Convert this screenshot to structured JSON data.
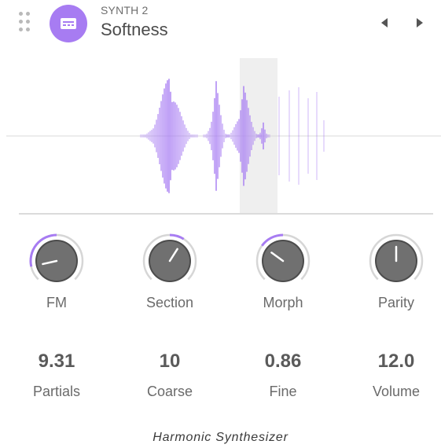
{
  "header": {
    "device_type": "SYNTH 2",
    "preset_name": "Softness",
    "accent_color": "#a77cf2"
  },
  "icons": {
    "drag": "drag-handle-icon",
    "device": "synth-device-icon",
    "prev": "triangle-left-icon",
    "next": "triangle-right-icon"
  },
  "knobs": [
    {
      "label": "FM",
      "level": 0.12
    },
    {
      "label": "Section",
      "level": 0.62
    },
    {
      "label": "Morph",
      "level": 0.3
    },
    {
      "label": "Parity",
      "level": 0.5
    }
  ],
  "values": [
    {
      "value": "9.31",
      "label": "Partials"
    },
    {
      "value": "10",
      "label": "Coarse"
    },
    {
      "value": "0.86",
      "label": "Fine"
    },
    {
      "value": "12.0",
      "label": "Volume"
    }
  ],
  "footer": {
    "title": "Harmonic Synthesizer"
  }
}
